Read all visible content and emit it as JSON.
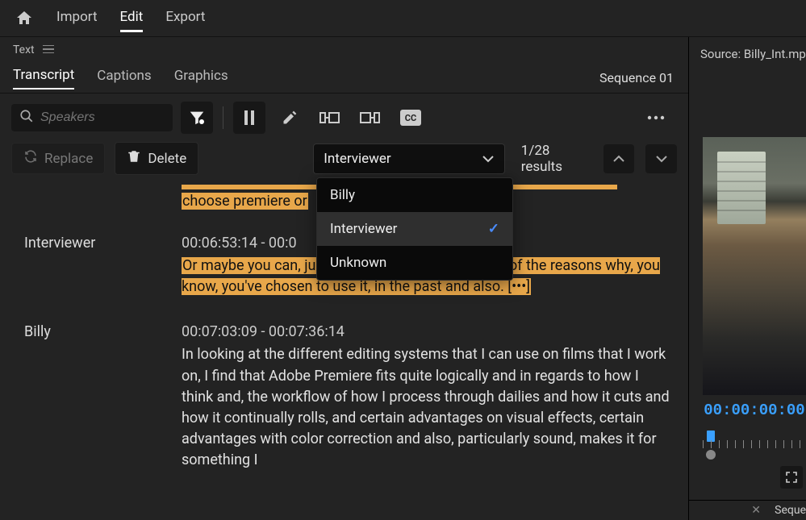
{
  "topnav": {
    "home": "home",
    "import": "Import",
    "edit": "Edit",
    "export": "Export",
    "active": "edit"
  },
  "panel": {
    "label": "Text"
  },
  "subtabs": {
    "transcript": "Transcript",
    "captions": "Captions",
    "graphics": "Graphics",
    "active": "transcript"
  },
  "sequence_label": "Sequence 01",
  "search": {
    "placeholder": "Speakers"
  },
  "actions": {
    "replace": "Replace",
    "delete": "Delete"
  },
  "speaker_select": {
    "value": "Interviewer"
  },
  "speaker_options": [
    {
      "label": "Billy",
      "selected": false
    },
    {
      "label": "Interviewer",
      "selected": true
    },
    {
      "label": "Unknown",
      "selected": false
    }
  ],
  "results": {
    "count": "1/28 results"
  },
  "segments": [
    {
      "speaker": "",
      "timestamp": "",
      "highlighted": true,
      "text_fragment_only": "choose premiere or"
    },
    {
      "speaker": "Interviewer",
      "timestamp": "00:06:53:14 - 00:0",
      "highlighted": true,
      "text": "Or maybe you can, just give me some of the, some of the reasons why, you know, you've chosen to use it, in the past and also. [•••]"
    },
    {
      "speaker": "Billy",
      "timestamp": "00:07:03:09 - 00:07:36:14",
      "highlighted": false,
      "text": "In looking at the different editing systems that I can use on films that I work on, I find that Adobe Premiere fits quite logically and in regards to how I think and, the workflow of how I process through dailies and how it cuts and how it continually rolls, and certain advantages on visual effects, certain advantages with color correction and also, particularly sound, makes it for something I"
    }
  ],
  "source": {
    "label": "Source: Billy_Int.mp"
  },
  "preview": {
    "timecode": "00:00:00:00"
  },
  "bottom": {
    "label": "Seque"
  }
}
